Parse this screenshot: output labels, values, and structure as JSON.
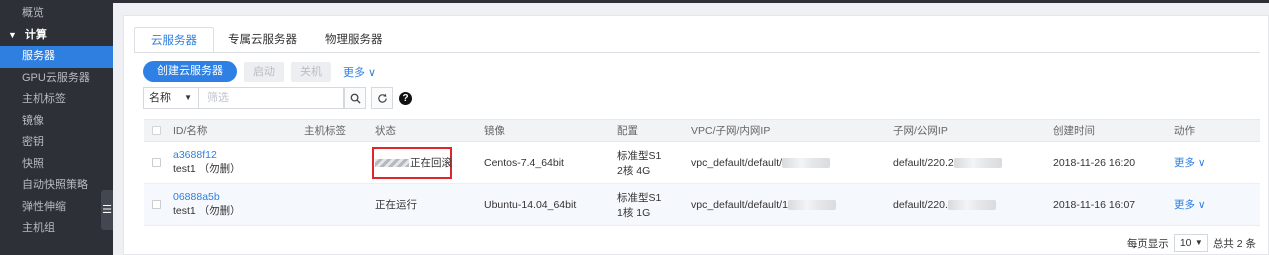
{
  "sidebar": {
    "items": [
      {
        "label": "概览",
        "type": "item"
      },
      {
        "label": "计算",
        "type": "group"
      },
      {
        "label": "服务器",
        "type": "active"
      },
      {
        "label": "GPU云服务器",
        "type": "item"
      },
      {
        "label": "主机标签",
        "type": "item"
      },
      {
        "label": "镜像",
        "type": "item"
      },
      {
        "label": "密钥",
        "type": "item"
      },
      {
        "label": "快照",
        "type": "item"
      },
      {
        "label": "自动快照策略",
        "type": "item"
      },
      {
        "label": "弹性伸缩",
        "type": "item"
      },
      {
        "label": "主机组",
        "type": "item"
      }
    ],
    "collapse_glyph": "☰"
  },
  "tabs": [
    "云服务器",
    "专属云服务器",
    "物理服务器"
  ],
  "toolbar": {
    "create_label": "创建云服务器",
    "start_label": "启动",
    "stop_label": "关机",
    "more_label": "更多 ∨"
  },
  "filter": {
    "field_value": "名称",
    "placeholder": "筛选",
    "help_glyph": "?"
  },
  "table": {
    "headers": [
      "ID/名称",
      "主机标签",
      "状态",
      "镜像",
      "配置",
      "VPC/子网/内网IP",
      "子网/公网IP",
      "创建时间",
      "动作"
    ],
    "rows": [
      {
        "id": "a3688f12",
        "name": "test1 （勿删）",
        "tag": "",
        "status": "正在回滚",
        "image": "Centos-7.4_64bit",
        "config_line1": "标准型S1",
        "config_line2": "2核 4G",
        "vpc": "vpc_default/default/",
        "public": "default/220.2",
        "created": "2018-11-26 16:20",
        "action": "更多 ∨"
      },
      {
        "id": "06888a5b",
        "name": "test1 （勿删）",
        "tag": "",
        "status": "正在运行",
        "image": "Ubuntu-14.04_64bit",
        "config_line1": "标准型S1",
        "config_line2": "1核 1G",
        "vpc": "vpc_default/default/1",
        "public": "default/220.",
        "created": "2018-11-16 16:07",
        "action": "更多 ∨"
      }
    ]
  },
  "pager": {
    "per_page_label": "每页显示",
    "per_page_value": "10",
    "total_label": "总共 2 条"
  },
  "colors": {
    "accent": "#2f7fe0",
    "highlight_box": "#e0262b",
    "sidebar_bg": "#2d3036"
  }
}
